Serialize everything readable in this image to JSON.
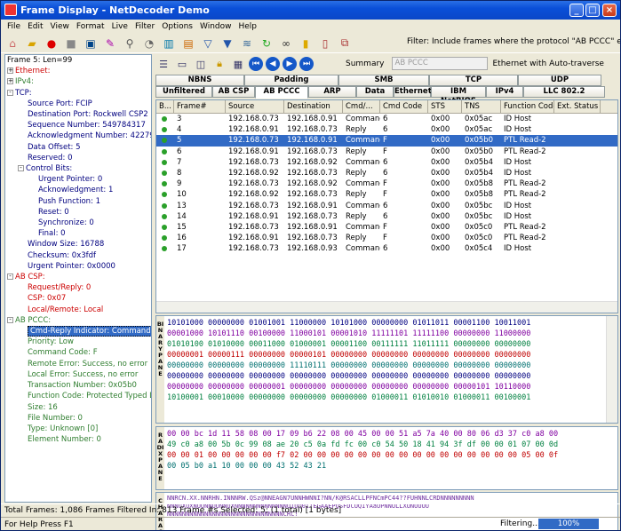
{
  "window": {
    "title": "Frame Display - NetDecoder Demo"
  },
  "menu": [
    "File",
    "Edit",
    "View",
    "Format",
    "Live",
    "Filter",
    "Options",
    "Window",
    "Help"
  ],
  "filter_text": "Filter:  Include frames where the protocol \"AB PCCC\" exists",
  "tree": [
    {
      "t": "Frame 5:  Len=99",
      "c": "",
      "i": 0,
      "b": ""
    },
    {
      "t": "Ethernet:",
      "c": "red",
      "i": 0,
      "b": "+"
    },
    {
      "t": "IPv4:",
      "c": "green",
      "i": 0,
      "b": "+"
    },
    {
      "t": "TCP:",
      "c": "blue",
      "i": 0,
      "b": "-"
    },
    {
      "t": "Source Port: FCIP",
      "c": "blue",
      "i": 1,
      "b": ""
    },
    {
      "t": "Destination Port: Rockwell CSP2",
      "c": "blue",
      "i": 1,
      "b": ""
    },
    {
      "t": "Sequence Number: 549784317",
      "c": "blue",
      "i": 1,
      "b": ""
    },
    {
      "t": "Acknowledgment Number: 4227907668",
      "c": "blue",
      "i": 1,
      "b": ""
    },
    {
      "t": "Data Offset: 5",
      "c": "blue",
      "i": 1,
      "b": ""
    },
    {
      "t": "Reserved: 0",
      "c": "blue",
      "i": 1,
      "b": ""
    },
    {
      "t": "Control Bits:",
      "c": "blue",
      "i": 1,
      "b": "-"
    },
    {
      "t": "Urgent Pointer: 0",
      "c": "blue",
      "i": 2,
      "b": ""
    },
    {
      "t": "Acknowledgment: 1",
      "c": "blue",
      "i": 2,
      "b": ""
    },
    {
      "t": "Push Function: 1",
      "c": "blue",
      "i": 2,
      "b": ""
    },
    {
      "t": "Reset: 0",
      "c": "blue",
      "i": 2,
      "b": ""
    },
    {
      "t": "Synchronize: 0",
      "c": "blue",
      "i": 2,
      "b": ""
    },
    {
      "t": "Final: 0",
      "c": "blue",
      "i": 2,
      "b": ""
    },
    {
      "t": "Window Size: 16788",
      "c": "blue",
      "i": 1,
      "b": ""
    },
    {
      "t": "Checksum: 0x3fdf",
      "c": "blue",
      "i": 1,
      "b": ""
    },
    {
      "t": "Urgent Pointer: 0x0000",
      "c": "blue",
      "i": 1,
      "b": ""
    },
    {
      "t": "AB CSP:",
      "c": "red",
      "i": 0,
      "b": "-"
    },
    {
      "t": "Request/Reply: 0",
      "c": "red",
      "i": 1,
      "b": ""
    },
    {
      "t": "CSP: 0x07",
      "c": "red",
      "i": 1,
      "b": ""
    },
    {
      "t": "Local/Remote: Local",
      "c": "red",
      "i": 1,
      "b": ""
    },
    {
      "t": "AB PCCC:",
      "c": "green",
      "i": 0,
      "b": "-"
    },
    {
      "t": "Cmd-Reply Indicator: Command",
      "c": "sel",
      "i": 1,
      "b": ""
    },
    {
      "t": "Priority: Low",
      "c": "green",
      "i": 1,
      "b": ""
    },
    {
      "t": "Command Code: F",
      "c": "green",
      "i": 1,
      "b": ""
    },
    {
      "t": "Remote Error: Success, no error",
      "c": "green",
      "i": 1,
      "b": ""
    },
    {
      "t": "Local Error: Success, no error",
      "c": "green",
      "i": 1,
      "b": ""
    },
    {
      "t": "Transaction Number: 0x05b0",
      "c": "green",
      "i": 1,
      "b": ""
    },
    {
      "t": "Function Code: Protected Typed Logica",
      "c": "green",
      "i": 1,
      "b": ""
    },
    {
      "t": "Size: 16",
      "c": "green",
      "i": 1,
      "b": ""
    },
    {
      "t": "File Number: 0",
      "c": "green",
      "i": 1,
      "b": ""
    },
    {
      "t": "Type: Unknown [0]",
      "c": "green",
      "i": 1,
      "b": ""
    },
    {
      "t": "Element Number: 0",
      "c": "green",
      "i": 1,
      "b": ""
    }
  ],
  "summary": {
    "label": "Summary",
    "value": "AB PCCC",
    "traverse": "Ethernet with Auto-traverse"
  },
  "tabs_row1": [
    "NBNS",
    "Padding",
    "SMB",
    "TCP",
    "UDP"
  ],
  "tabs_row2": [
    "Unfiltered",
    "AB CSP",
    "AB PCCC",
    "ARP",
    "Data",
    "Ethernet",
    "IBM NetBIOS",
    "IPv4",
    "LLC 802.2"
  ],
  "columns": [
    "B...",
    "Frame#",
    "Source",
    "Destination",
    "Cmd/...",
    "Cmd Code",
    "STS",
    "TNS",
    "Function Code",
    "Ext. Status"
  ],
  "rows": [
    [
      "3",
      "192.168.0.73",
      "192.168.0.91",
      "Command",
      "6",
      "0x00",
      "0x05ac",
      "ID Host",
      ""
    ],
    [
      "4",
      "192.168.0.91",
      "192.168.0.73",
      "Reply",
      "6",
      "0x00",
      "0x05ac",
      "ID Host",
      ""
    ],
    [
      "5",
      "192.168.0.73",
      "192.168.0.91",
      "Command",
      "F",
      "0x00",
      "0x05b0",
      "PTL Read-2",
      ""
    ],
    [
      "6",
      "192.168.0.91",
      "192.168.0.73",
      "Reply",
      "F",
      "0x00",
      "0x05b0",
      "PTL Read-2",
      ""
    ],
    [
      "7",
      "192.168.0.73",
      "192.168.0.92",
      "Command",
      "6",
      "0x00",
      "0x05b4",
      "ID Host",
      ""
    ],
    [
      "8",
      "192.168.0.92",
      "192.168.0.73",
      "Reply",
      "6",
      "0x00",
      "0x05b4",
      "ID Host",
      ""
    ],
    [
      "9",
      "192.168.0.73",
      "192.168.0.92",
      "Command",
      "F",
      "0x00",
      "0x05b8",
      "PTL Read-2",
      ""
    ],
    [
      "10",
      "192.168.0.92",
      "192.168.0.73",
      "Reply",
      "F",
      "0x00",
      "0x05b8",
      "PTL Read-2",
      ""
    ],
    [
      "13",
      "192.168.0.73",
      "192.168.0.91",
      "Command",
      "6",
      "0x00",
      "0x05bc",
      "ID Host",
      ""
    ],
    [
      "14",
      "192.168.0.91",
      "192.168.0.73",
      "Reply",
      "6",
      "0x00",
      "0x05bc",
      "ID Host",
      ""
    ],
    [
      "15",
      "192.168.0.73",
      "192.168.0.91",
      "Command",
      "F",
      "0x00",
      "0x05c0",
      "PTL Read-2",
      ""
    ],
    [
      "16",
      "192.168.0.91",
      "192.168.0.73",
      "Reply",
      "F",
      "0x00",
      "0x05c0",
      "PTL Read-2",
      ""
    ],
    [
      "17",
      "192.168.0.73",
      "192.168.0.93",
      "Command",
      "6",
      "0x00",
      "0x05c4",
      "ID Host",
      ""
    ]
  ],
  "selected_row": 2,
  "binary_lines": [
    "10101000 00000000 01001001 11000000 10101000 00000000 01011011 00001100 10011001",
    "00001000 10101110 00100000 11000101 00001010 11111101 11111100 00000000 11000000",
    "01010100 01010000 00011000 01000001 00001100 00111111 11011111 00000000 00000000",
    "00000001 00000111 00000000 00000101 00000000 00000000 00000000 00000000 00000000",
    "00000000 00000000 00000000 11110111 00000000 00000000 00000000 00000000 00000000",
    "00000000 00000000 00000000 00000000 00000000 00000000 00000000 00000000 00000000",
    "00000000 00000000 00000001 00000000 00000000 00000000 00000000 00000101 10110000",
    "10100001 00010000 00000000 00000000 00000000 01000011 01010010 01000011 00100001"
  ],
  "binary_label": "BINARY PANE",
  "radix_lines": [
    "00 00 bc 1d 11 58 08 00 17 09 b6 22 08 00 45 00 00 51 a5 7a 40 00 80 06 d3 37 c0 a8 00",
    "49 c0 a8 00 5b 0c 99 08 ae 20 c5 0a fd fc 00 c0 54 50 18 41 94 3f df 00 00 01 07 00 0d",
    "00 00 01 00 00 00 00 00 f7 02 00 00 00 00 00 00 00 00 00 00 00 00 00 00 00 00 05 00 0f",
    "00 05 b0 a1 10 00 00 00 43 52 43 21"
  ],
  "radix_label": "RADIX PANE",
  "char_lines": [
    "NNRCN.XX.NNRHN.INNNRW.QSz@NNEAGN7UNNHWNNI?NN/K@RSACLLPFNCmPC44??FUHNNLCRDNNNNNNNNN",
    "NNNUXUXNUUNNUUNNUXNNNNNNNNNNNNNNUIUQ0ITEGAAEPQSFDCUQIYAaUPNNULLXUNUUUU",
    "NNNNNNNNNNNNNNNNNNNNNNNNNNNNNNNCRC!"
  ],
  "char_label": "CHARACTER PANE",
  "status1": "Total Frames:   1,086   Frames Filtered In:   813   Frame #s Selected:   5; (1 total) [1 bytes]",
  "status2": "For Help Press F1",
  "filtering": "Filtering...",
  "progress": "100%",
  "progress_value": 100
}
